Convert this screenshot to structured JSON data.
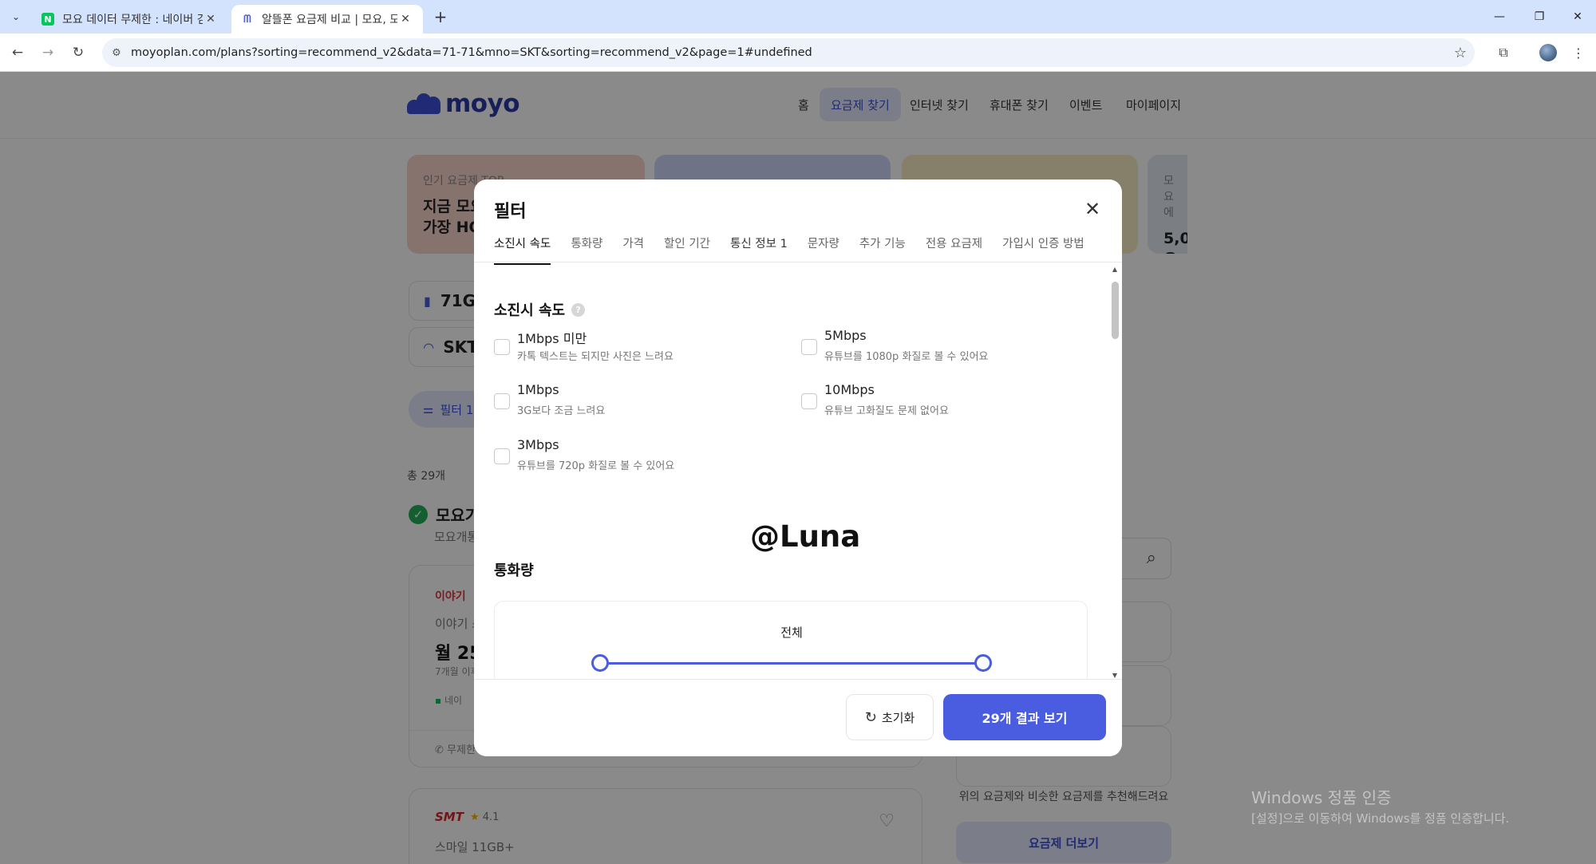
{
  "browser": {
    "tabs": [
      {
        "title": "모요 데이터 무제한 : 네이버 검",
        "active": false
      },
      {
        "title": "알뜰폰 요금제 비교 | 모요, 모두",
        "active": true
      }
    ],
    "url": "moyoplan.com/plans?sorting=recommend_v2&data=71-71&mno=SKT&sorting=recommend_v2&page=1#undefined"
  },
  "site": {
    "logo": "moyo",
    "nav": [
      "홈",
      "요금제 찾기",
      "인터넷 찾기",
      "휴대폰 찾기",
      "이벤트",
      "마이페이지"
    ],
    "banner_cards": [
      {
        "small": "인기 요금제 TOP",
        "big1": "지금 모요",
        "big2": "가장 HO"
      },
      {
        "small": "",
        "big1": "",
        "big2": ""
      },
      {
        "small": "",
        "big1": "",
        "big2": ""
      },
      {
        "small": "모요에",
        "big1": "5,0",
        "big2": "요금"
      }
    ],
    "chips": [
      {
        "icon": "signal-icon",
        "label": "71GB"
      },
      {
        "icon": "wifi-icon",
        "label": "SKT"
      }
    ],
    "filter_pill": "필터 1개",
    "total": "총 29개",
    "verified_title": "모요가",
    "verified_sub": "모요개통",
    "plan1": {
      "brand": "이야기",
      "name": "이야기 스",
      "price": "월 25,",
      "note": "7개월 이후",
      "badge": "네이",
      "features": "무제한"
    },
    "plan2": {
      "brand": "SMT",
      "rating": "4.1",
      "name": "스마일 11GB+"
    },
    "rec_text": "위의 요금제와 비슷한 요금제를 추천해드려요",
    "more_btn": "요금제 더보기"
  },
  "modal": {
    "title": "필터",
    "tabs": [
      "소진시 속도",
      "통화량",
      "가격",
      "할인 기간",
      "통신 정보 1",
      "문자량",
      "추가 기능",
      "전용 요금제",
      "가입시 인증 방법"
    ],
    "speed": {
      "title": "소진시 속도",
      "options": [
        {
          "label": "1Mbps 미만",
          "desc": "카톡 텍스트는 되지만 사진은 느려요",
          "checked": false
        },
        {
          "label": "5Mbps",
          "desc": "유튜브를 1080p 화질로 볼 수 있어요",
          "checked": false
        },
        {
          "label": "1Mbps",
          "desc": "3G보다 조금 느려요",
          "checked": false
        },
        {
          "label": "10Mbps",
          "desc": "유튜브 고화질도 문제 없어요",
          "checked": false
        },
        {
          "label": "3Mbps",
          "desc": "유튜브를 720p 화질로 볼 수 있어요",
          "checked": false
        }
      ]
    },
    "call": {
      "title": "통화량",
      "range_label": "전체",
      "min_pct": 0,
      "max_pct": 100
    },
    "watermark": "@Luna",
    "reset_label": "초기화",
    "apply_label": "29개 결과 보기"
  },
  "os": {
    "activate_line1": "Windows 정품 인증",
    "activate_line2": "[설정]으로 이동하여 Windows를 정품 인증합니다."
  },
  "colors": {
    "accent": "#4a5ce0",
    "accent_light": "#e4e9fb",
    "overlay": "rgba(0,0,0,0.46)"
  }
}
